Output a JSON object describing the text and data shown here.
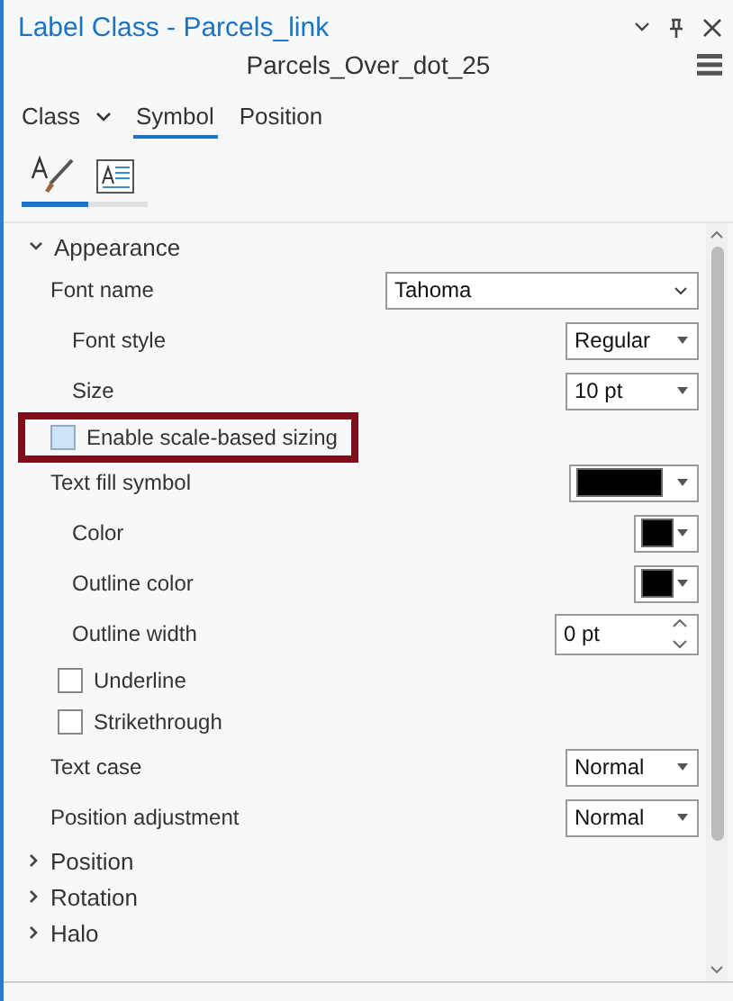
{
  "window": {
    "title": "Label Class - Parcels_link",
    "subtitle": "Parcels_Over_dot_25"
  },
  "tabs": [
    {
      "label": "Class",
      "selected": false,
      "has_menu": true
    },
    {
      "label": "Symbol",
      "selected": true,
      "has_menu": false
    },
    {
      "label": "Position",
      "selected": false,
      "has_menu": false
    }
  ],
  "icon_tabs": [
    {
      "kind": "symbol",
      "selected": true
    },
    {
      "kind": "text",
      "selected": false
    }
  ],
  "sections": [
    {
      "label": "Appearance",
      "expanded": true,
      "rows": [
        {
          "kind": "wide_dropdown",
          "label": "Font name",
          "value": "Tahoma",
          "children": [
            {
              "kind": "dropdown",
              "label": "Font style",
              "value": "Regular"
            },
            {
              "kind": "dropdown",
              "label": "Size",
              "value": "10 pt"
            }
          ]
        },
        {
          "kind": "checkbox",
          "label": "Enable scale-based sizing",
          "checked": false,
          "highlighted": true
        },
        {
          "kind": "symbol",
          "label": "Text fill symbol",
          "color": "#000000",
          "children": [
            {
              "kind": "color",
              "label": "Color",
              "color": "#000000"
            },
            {
              "kind": "color",
              "label": "Outline color",
              "color": "#000000"
            },
            {
              "kind": "spin",
              "label": "Outline width",
              "value": "0 pt"
            }
          ]
        },
        {
          "kind": "checkbox",
          "label": "Underline",
          "checked": false,
          "highlighted": false
        },
        {
          "kind": "checkbox",
          "label": "Strikethrough",
          "checked": false,
          "highlighted": false
        },
        {
          "kind": "dropdown",
          "label": "Text case",
          "value": "Normal"
        },
        {
          "kind": "dropdown",
          "label": "Position adjustment",
          "value": "Normal"
        }
      ]
    },
    {
      "label": "Position",
      "expanded": false
    },
    {
      "label": "Rotation",
      "expanded": false
    },
    {
      "label": "Halo",
      "expanded": false
    }
  ]
}
